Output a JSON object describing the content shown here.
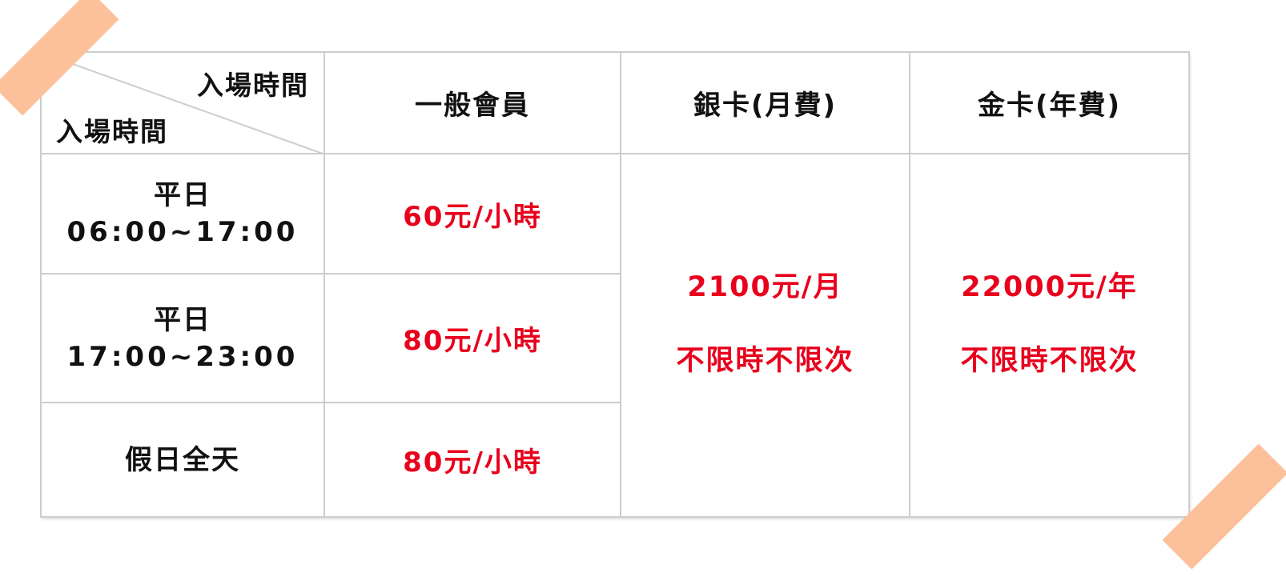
{
  "header": {
    "corner_top": "入場時間",
    "corner_bottom": "入場時間",
    "col_general": "一般會員",
    "col_silver": "銀卡(月費)",
    "col_gold": "金卡(年費)"
  },
  "rows": [
    {
      "label_line1": "平日",
      "label_line2": "06:00~17:00",
      "general_price": "60元/小時"
    },
    {
      "label_line1": "平日",
      "label_line2": "17:00~23:00",
      "general_price": "80元/小時"
    },
    {
      "label_line1": "假日全天",
      "label_line2": "",
      "general_price": "80元/小時"
    }
  ],
  "silver": {
    "price": "2100元/月",
    "note": "不限時不限次"
  },
  "gold": {
    "price": "22000元/年",
    "note": "不限時不限次"
  },
  "colors": {
    "price_red": "#e8001c",
    "tape": "#fcc09a",
    "border": "#cdcdcd"
  }
}
